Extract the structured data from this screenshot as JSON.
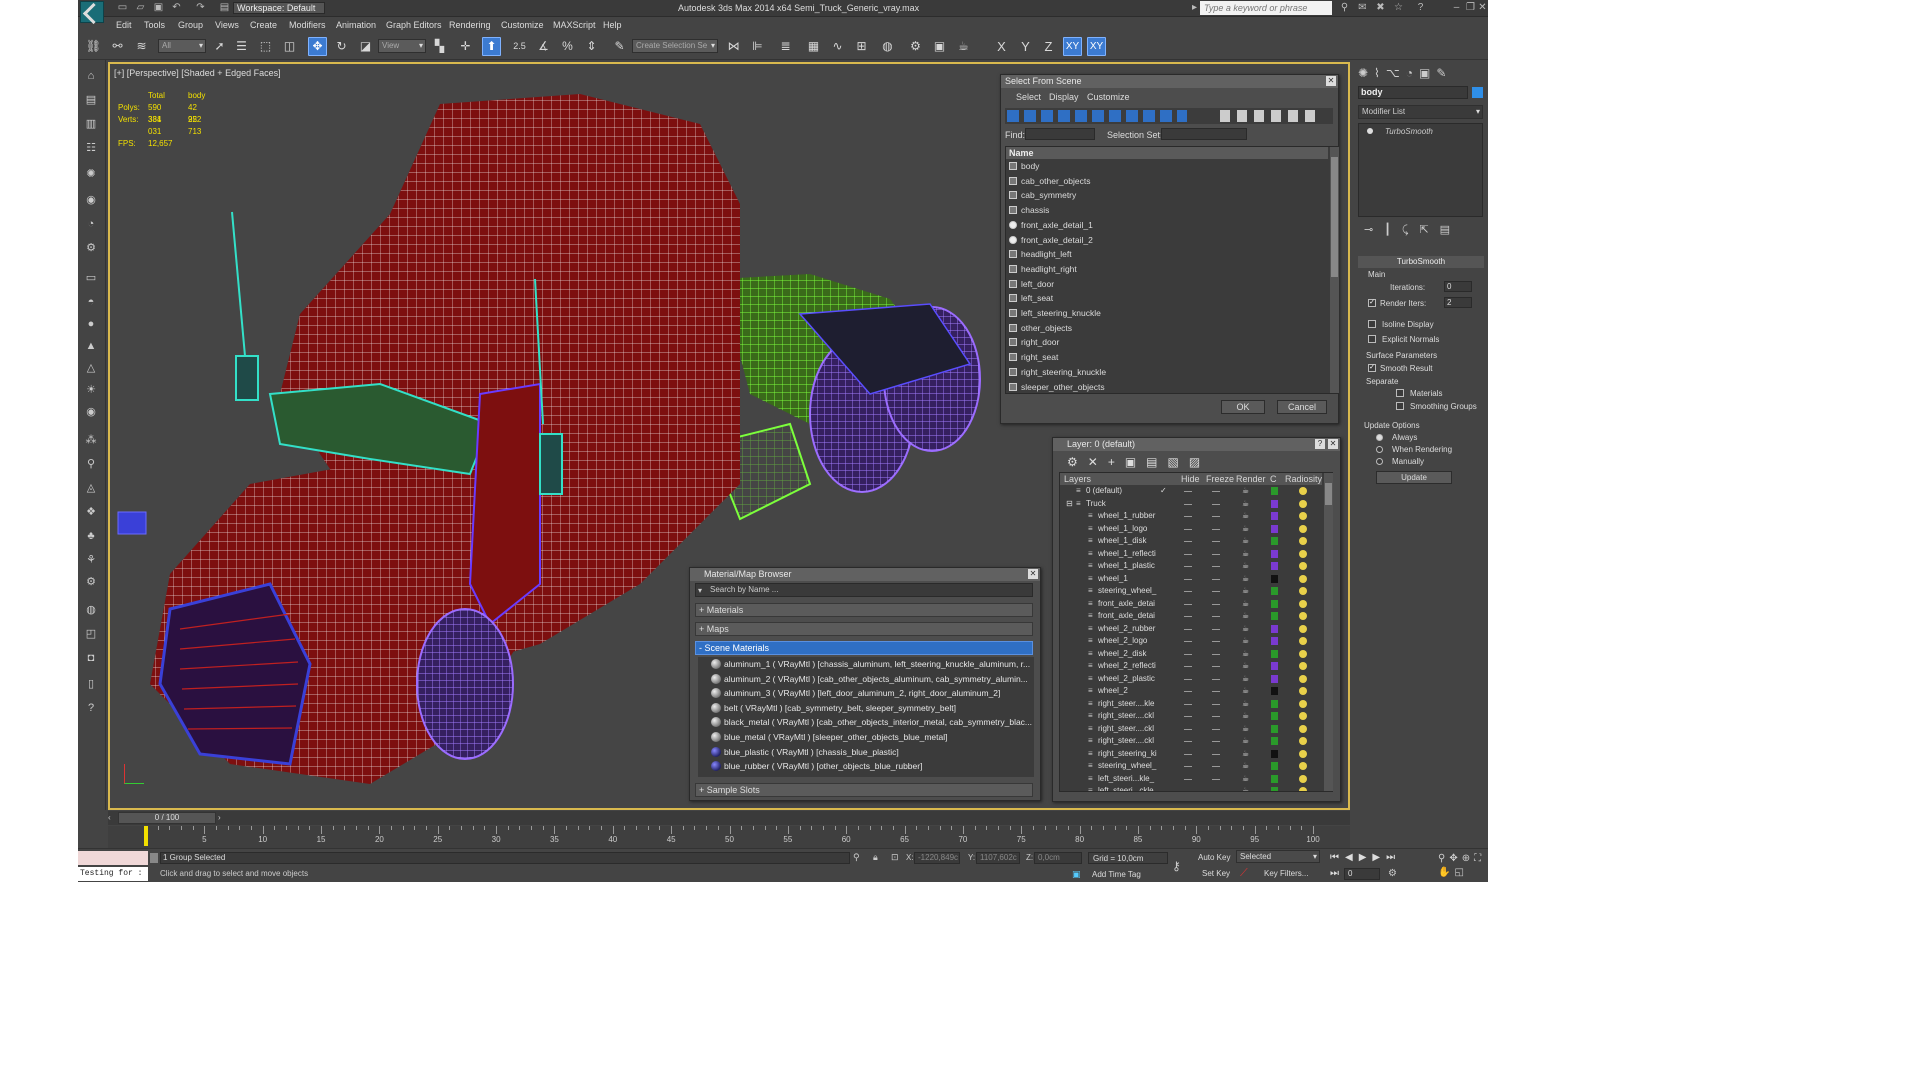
{
  "titlebar": {
    "workspace": "Workspace: Default",
    "title": "Autodesk 3ds Max  2014 x64     Semi_Truck_Generic_vray.max",
    "search_placeholder": "Type a keyword or phrase"
  },
  "menu": [
    "Edit",
    "Tools",
    "Group",
    "Views",
    "Create",
    "Modifiers",
    "Animation",
    "Graph Editors",
    "Rendering",
    "Customize",
    "MAXScript",
    "Help"
  ],
  "toolbar": {
    "filter_value": "All",
    "ref_coord": "View",
    "selection_set_placeholder": "Create Selection Se",
    "snap_label": "2.5",
    "axis_labels": [
      "X",
      "Y",
      "Z",
      "XY",
      "XY"
    ]
  },
  "viewport": {
    "label": "[+] [Perspective] [Shaded + Edged Faces]",
    "stats": {
      "col_total": "Total",
      "col_body": "body",
      "polys_label": "Polys:",
      "polys_total": "590 381",
      "polys_body": "42 952",
      "verts_label": "Verts:",
      "verts_total": "334 031",
      "verts_body": "22 713",
      "fps_label": "FPS:",
      "fps_value": "12,657"
    },
    "colors": {
      "body": "#8a1010",
      "wire": "#ffffff",
      "chassis": "#6fe03a",
      "wheels": "#8e5cf0",
      "glass": "#33e0c8",
      "blue": "#3340d0"
    }
  },
  "select_from_scene": {
    "title": "Select From Scene",
    "tabs": [
      "Select",
      "Display",
      "Customize"
    ],
    "find_label": "Find:",
    "selection_set_label": "Selection Set:",
    "column": "Name",
    "items": [
      "body",
      "cab_other_objects",
      "cab_symmetry",
      "chassis",
      "front_axle_detail_1",
      "front_axle_detail_2",
      "headlight_left",
      "headlight_right",
      "left_door",
      "left_seat",
      "left_steering_knuckle",
      "other_objects",
      "right_door",
      "right_seat",
      "right_steering_knuckle",
      "sleeper_other_objects"
    ],
    "ok": "OK",
    "cancel": "Cancel"
  },
  "layer_dialog": {
    "title": "Layer: 0 (default)",
    "columns": [
      "Layers",
      "Hide",
      "Freeze",
      "Render",
      "C",
      "Radiosity"
    ],
    "rows": [
      {
        "name": "0 (default)",
        "color": "#2a9a2a",
        "level": 0
      },
      {
        "name": "Truck",
        "color": "#7a3ad0",
        "level": 0
      },
      {
        "name": "wheel_1_rubber",
        "color": "#7a3ad0",
        "level": 1
      },
      {
        "name": "wheel_1_logo",
        "color": "#7a3ad0",
        "level": 1
      },
      {
        "name": "wheel_1_disk",
        "color": "#2a9a2a",
        "level": 1
      },
      {
        "name": "wheel_1_reflecti",
        "color": "#7a3ad0",
        "level": 1
      },
      {
        "name": "wheel_1_plastic",
        "color": "#7a3ad0",
        "level": 1
      },
      {
        "name": "wheel_1",
        "color": "#111111",
        "level": 1
      },
      {
        "name": "steering_wheel_",
        "color": "#2a9a2a",
        "level": 1
      },
      {
        "name": "front_axle_detai",
        "color": "#2a9a2a",
        "level": 1
      },
      {
        "name": "front_axle_detai",
        "color": "#2a9a2a",
        "level": 1
      },
      {
        "name": "wheel_2_rubber",
        "color": "#7a3ad0",
        "level": 1
      },
      {
        "name": "wheel_2_logo",
        "color": "#7a3ad0",
        "level": 1
      },
      {
        "name": "wheel_2_disk",
        "color": "#2a9a2a",
        "level": 1
      },
      {
        "name": "wheel_2_reflecti",
        "color": "#7a3ad0",
        "level": 1
      },
      {
        "name": "wheel_2_plastic",
        "color": "#7a3ad0",
        "level": 1
      },
      {
        "name": "wheel_2",
        "color": "#111111",
        "level": 1
      },
      {
        "name": "right_steer....kle",
        "color": "#2a9a2a",
        "level": 1
      },
      {
        "name": "right_steer....ckl",
        "color": "#2a9a2a",
        "level": 1
      },
      {
        "name": "right_steer....ckl",
        "color": "#2a9a2a",
        "level": 1
      },
      {
        "name": "right_steer....ckl",
        "color": "#2a9a2a",
        "level": 1
      },
      {
        "name": "right_steering_ki",
        "color": "#111111",
        "level": 1
      },
      {
        "name": "steering_wheel_",
        "color": "#2a9a2a",
        "level": 1
      },
      {
        "name": "left_steeri...kle_",
        "color": "#2a9a2a",
        "level": 1
      },
      {
        "name": "left_steeri...ckle",
        "color": "#2a9a2a",
        "level": 1
      }
    ]
  },
  "material_browser": {
    "title": "Material/Map Browser",
    "search_placeholder": "Search by Name ...",
    "sections": [
      "+ Materials",
      "+ Maps",
      "- Scene Materials",
      "+ Sample Slots"
    ],
    "items": [
      "aluminum_1  ( VRayMtl ) [chassis_aluminum, left_steering_knuckle_aluminum, r...",
      "aluminum_2  ( VRayMtl ) [cab_other_objects_aluminum, cab_symmetry_alumin...",
      "aluminum_3  ( VRayMtl ) [left_door_aluminum_2, right_door_aluminum_2]",
      "belt  ( VRayMtl ) [cab_symmetry_belt, sleeper_symmetry_belt]",
      "black_metal  ( VRayMtl ) [cab_other_objects_interior_metal, cab_symmetry_blac...",
      "blue_metal  ( VRayMtl ) [sleeper_other_objects_blue_metal]",
      "blue_plastic  ( VRayMtl ) [chassis_blue_plastic]",
      "blue_rubber  ( VRayMtl ) [other_objects_blue_rubber]"
    ]
  },
  "command_panel": {
    "object_name": "body",
    "modifier_list": "Modifier List",
    "stack_item": "TurboSmooth",
    "rollout_title": "TurboSmooth",
    "main_label": "Main",
    "iterations_label": "Iterations:",
    "iterations_value": "0",
    "render_iters_label": "Render Iters:",
    "render_iters_value": "2",
    "render_iters_checked": true,
    "isoline_label": "Isoline Display",
    "explicit_normals_label": "Explicit Normals",
    "surface_params_label": "Surface Parameters",
    "smooth_result_label": "Smooth Result",
    "smooth_result_checked": true,
    "separate_label": "Separate",
    "materials_label": "Materials",
    "smoothing_groups_label": "Smoothing Groups",
    "update_options_label": "Update Options",
    "always_label": "Always",
    "when_rendering_label": "When Rendering",
    "manually_label": "Manually",
    "update_button": "Update"
  },
  "timeline": {
    "frame_display": "0 / 100",
    "ticks": [
      "0",
      "5",
      "10",
      "15",
      "20",
      "25",
      "30",
      "35",
      "40",
      "45",
      "50",
      "55",
      "60",
      "65",
      "70",
      "75",
      "80",
      "85",
      "90",
      "95",
      "100"
    ]
  },
  "status": {
    "maxscript_text": "Testing for :",
    "selection_status": "1 Group Selected",
    "prompt": "Click and drag to select and move objects",
    "x_label": "X:",
    "x_value": "-1220,849c",
    "y_label": "Y:",
    "y_value": "1107,602c",
    "z_label": "Z:",
    "z_value": "0,0cm",
    "grid": "Grid = 10,0cm",
    "add_time_tag": "Add Time Tag",
    "auto_key": "Auto Key",
    "selected_dropdown": "Selected",
    "set_key": "Set Key",
    "key_filters": "Key Filters...",
    "frame_value": "0"
  }
}
